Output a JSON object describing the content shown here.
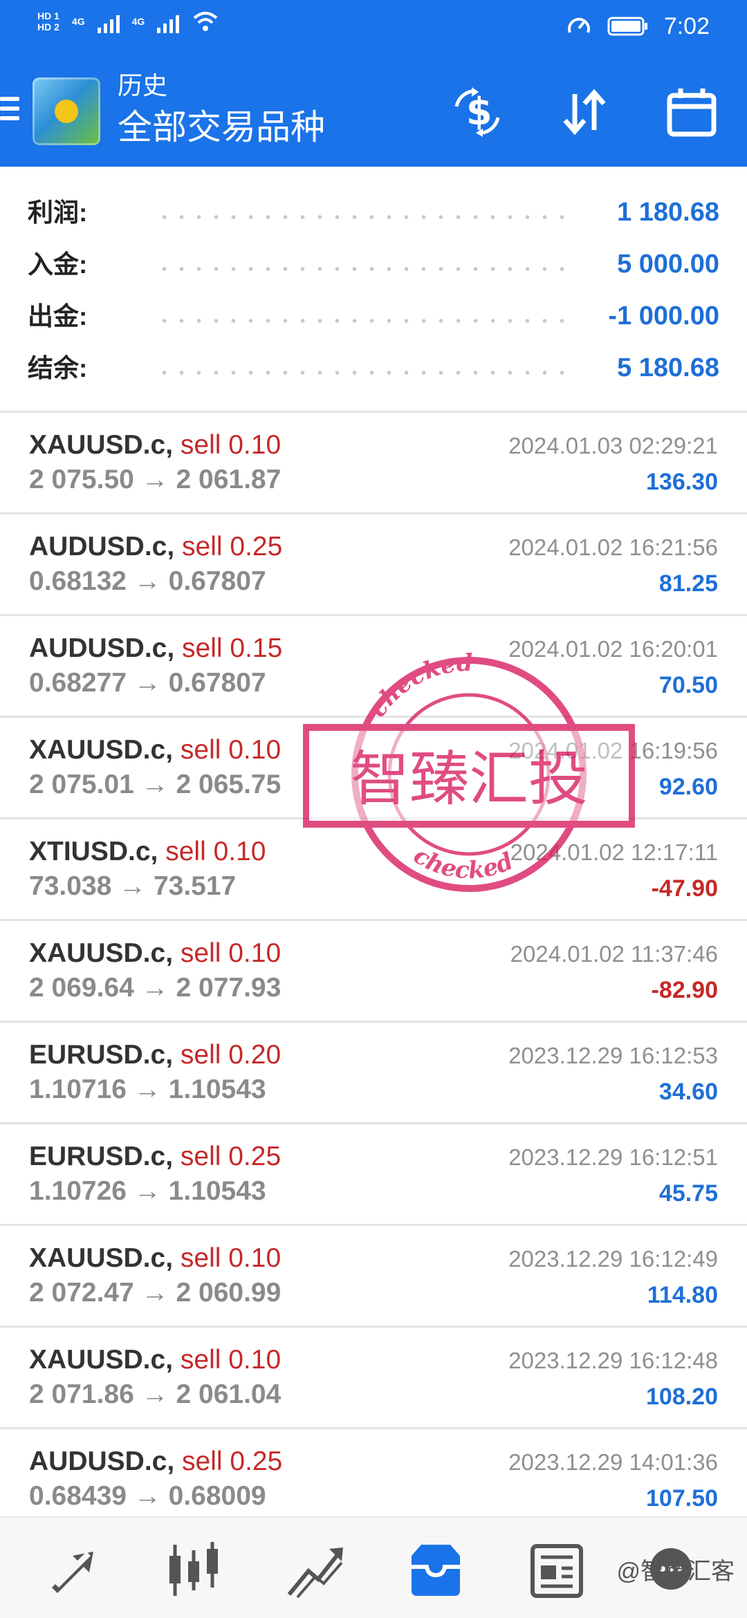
{
  "status_bar": {
    "time": "7:02",
    "sim1": "HD 1",
    "sim2": "HD 2",
    "net1": "4G",
    "net2": "4G"
  },
  "header": {
    "subtitle": "历史",
    "title": "全部交易品种",
    "icons": [
      "dollar-exchange-icon",
      "sort-icon",
      "calendar-icon"
    ]
  },
  "summary": {
    "profit_label": "利润:",
    "profit_value": "1 180.68",
    "deposit_label": "入金:",
    "deposit_value": "5 000.00",
    "withdrawal_label": "出金:",
    "withdrawal_value": "-1 000.00",
    "balance_label": "结余:",
    "balance_value": "5 180.68"
  },
  "trades": [
    {
      "symbol": "XAUUSD.c,",
      "side": "sell 0.10",
      "prices": "2 075.50 → 2 061.87",
      "time": "2024.01.03 02:29:21",
      "profit": "136.30",
      "positive": true
    },
    {
      "symbol": "AUDUSD.c,",
      "side": "sell 0.25",
      "prices": "0.68132 → 0.67807",
      "time": "2024.01.02 16:21:56",
      "profit": "81.25",
      "positive": true
    },
    {
      "symbol": "AUDUSD.c,",
      "side": "sell 0.15",
      "prices": "0.68277 → 0.67807",
      "time": "2024.01.02 16:20:01",
      "profit": "70.50",
      "positive": true
    },
    {
      "symbol": "XAUUSD.c,",
      "side": "sell 0.10",
      "prices": "2 075.01 → 2 065.75",
      "time": "2024.01.02 16:19:56",
      "profit": "92.60",
      "positive": true
    },
    {
      "symbol": "XTIUSD.c,",
      "side": "sell 0.10",
      "prices": "73.038 → 73.517",
      "time": "2024.01.02 12:17:11",
      "profit": "-47.90",
      "positive": false
    },
    {
      "symbol": "XAUUSD.c,",
      "side": "sell 0.10",
      "prices": "2 069.64 → 2 077.93",
      "time": "2024.01.02 11:37:46",
      "profit": "-82.90",
      "positive": false
    },
    {
      "symbol": "EURUSD.c,",
      "side": "sell 0.20",
      "prices": "1.10716 → 1.10543",
      "time": "2023.12.29 16:12:53",
      "profit": "34.60",
      "positive": true
    },
    {
      "symbol": "EURUSD.c,",
      "side": "sell 0.25",
      "prices": "1.10726 → 1.10543",
      "time": "2023.12.29 16:12:51",
      "profit": "45.75",
      "positive": true
    },
    {
      "symbol": "XAUUSD.c,",
      "side": "sell 0.10",
      "prices": "2 072.47 → 2 060.99",
      "time": "2023.12.29 16:12:49",
      "profit": "114.80",
      "positive": true
    },
    {
      "symbol": "XAUUSD.c,",
      "side": "sell 0.10",
      "prices": "2 071.86 → 2 061.04",
      "time": "2023.12.29 16:12:48",
      "profit": "108.20",
      "positive": true
    },
    {
      "symbol": "AUDUSD.c,",
      "side": "sell 0.25",
      "prices": "0.68439 → 0.68009",
      "time": "2023.12.29 14:01:36",
      "profit": "107.50",
      "positive": true
    }
  ],
  "stamp": {
    "text": "智臻汇投",
    "ring_text": "checked"
  },
  "bottom_nav": {
    "items": [
      "quotes-icon",
      "chart-candles-icon",
      "trade-icon",
      "history-icon",
      "news-icon",
      "chat-icon"
    ],
    "active": "history-icon",
    "watermark": "@智臻汇客"
  },
  "colors": {
    "primary": "#1a73e8",
    "profit_positive": "#1e6fd6",
    "profit_negative": "#c62828",
    "stamp": "#d81b60"
  }
}
